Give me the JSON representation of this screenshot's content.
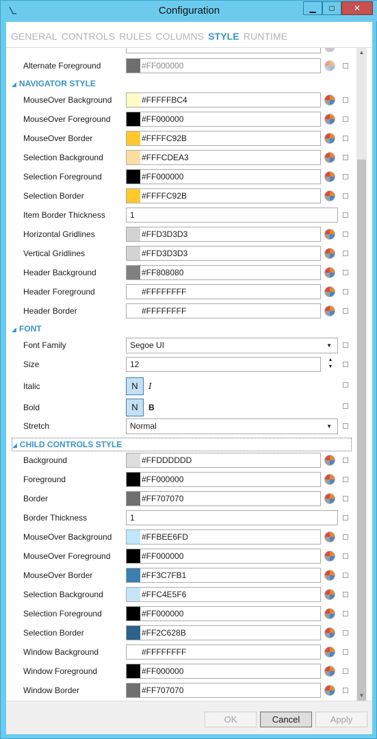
{
  "window": {
    "title": "Configuration",
    "minimize_glyph": "▁",
    "maximize_glyph": "□",
    "close_glyph": "✕"
  },
  "tabs": [
    {
      "label": "GENERAL",
      "active": false
    },
    {
      "label": "CONTROLS",
      "active": false
    },
    {
      "label": "RULES",
      "active": false
    },
    {
      "label": "COLUMNS",
      "active": false
    },
    {
      "label": "STYLE",
      "active": true
    },
    {
      "label": "RUNTIME",
      "active": false
    }
  ],
  "colors": {
    "accent": "#3a93c8",
    "titlebar": "#6ccbed",
    "close_button": "#c75050"
  },
  "top_rows": [
    {
      "label": "Alternate Foreground",
      "value": "#FF000000",
      "swatch": "#6e6e6e",
      "disabled": true
    }
  ],
  "navigator_style": {
    "header": "NAVIGATOR STYLE",
    "rows": [
      {
        "label": "MouseOver Background",
        "value": "#FFFFFBC4",
        "swatch": "#fffbc4"
      },
      {
        "label": "MouseOver Foreground",
        "value": "#FF000000",
        "swatch": "#000000"
      },
      {
        "label": "MouseOver Border",
        "value": "#FFFFC92B",
        "swatch": "#ffc92b"
      },
      {
        "label": "Selection Background",
        "value": "#FFFCDEA3",
        "swatch": "#fcdea3"
      },
      {
        "label": "Selection Foreground",
        "value": "#FF000000",
        "swatch": "#000000"
      },
      {
        "label": "Selection Border",
        "value": "#FFFFC92B",
        "swatch": "#ffc92b"
      },
      {
        "label": "Item Border Thickness",
        "value": "1",
        "kind": "text"
      },
      {
        "label": "Horizontal Gridlines",
        "value": "#FFD3D3D3",
        "swatch": "#d3d3d3"
      },
      {
        "label": "Vertical Gridlines",
        "value": "#FFD3D3D3",
        "swatch": "#d3d3d3"
      },
      {
        "label": "Header Background",
        "value": "#FF808080",
        "swatch": "#808080"
      },
      {
        "label": "Header Foreground",
        "value": "#FFFFFFFF",
        "swatch": "#ffffff"
      },
      {
        "label": "Header Border",
        "value": "#FFFFFFFF",
        "swatch": "#ffffff"
      }
    ]
  },
  "font": {
    "header": "FONT",
    "family_label": "Font Family",
    "family_value": "Segoe UI",
    "size_label": "Size",
    "size_value": "12",
    "italic_label": "Italic",
    "italic_toggle": "N",
    "italic_sample": "I",
    "bold_label": "Bold",
    "bold_toggle": "N",
    "bold_sample": "B",
    "stretch_label": "Stretch",
    "stretch_value": "Normal"
  },
  "child_controls_style": {
    "header": "CHILD CONTROLS STYLE",
    "rows": [
      {
        "label": "Background",
        "value": "#FFDDDDDD",
        "swatch": "#dddddd"
      },
      {
        "label": "Foreground",
        "value": "#FF000000",
        "swatch": "#000000"
      },
      {
        "label": "Border",
        "value": "#FF707070",
        "swatch": "#707070"
      },
      {
        "label": "Border Thickness",
        "value": "1",
        "kind": "text"
      },
      {
        "label": "MouseOver Background",
        "value": "#FFBEE6FD",
        "swatch": "#bee6fd"
      },
      {
        "label": "MouseOver Foreground",
        "value": "#FF000000",
        "swatch": "#000000"
      },
      {
        "label": "MouseOver Border",
        "value": "#FF3C7FB1",
        "swatch": "#3c7fb1"
      },
      {
        "label": "Selection Background",
        "value": "#FFC4E5F6",
        "swatch": "#c4e5f6"
      },
      {
        "label": "Selection Foreground",
        "value": "#FF000000",
        "swatch": "#000000"
      },
      {
        "label": "Selection Border",
        "value": "#FF2C628B",
        "swatch": "#2c628b"
      },
      {
        "label": "Window Background",
        "value": "#FFFFFFFF",
        "swatch": "#ffffff"
      },
      {
        "label": "Window Foreground",
        "value": "#FF000000",
        "swatch": "#000000"
      },
      {
        "label": "Window Border",
        "value": "#FF707070",
        "swatch": "#707070"
      }
    ]
  },
  "buttons": {
    "ok": "OK",
    "cancel": "Cancel",
    "apply": "Apply"
  }
}
